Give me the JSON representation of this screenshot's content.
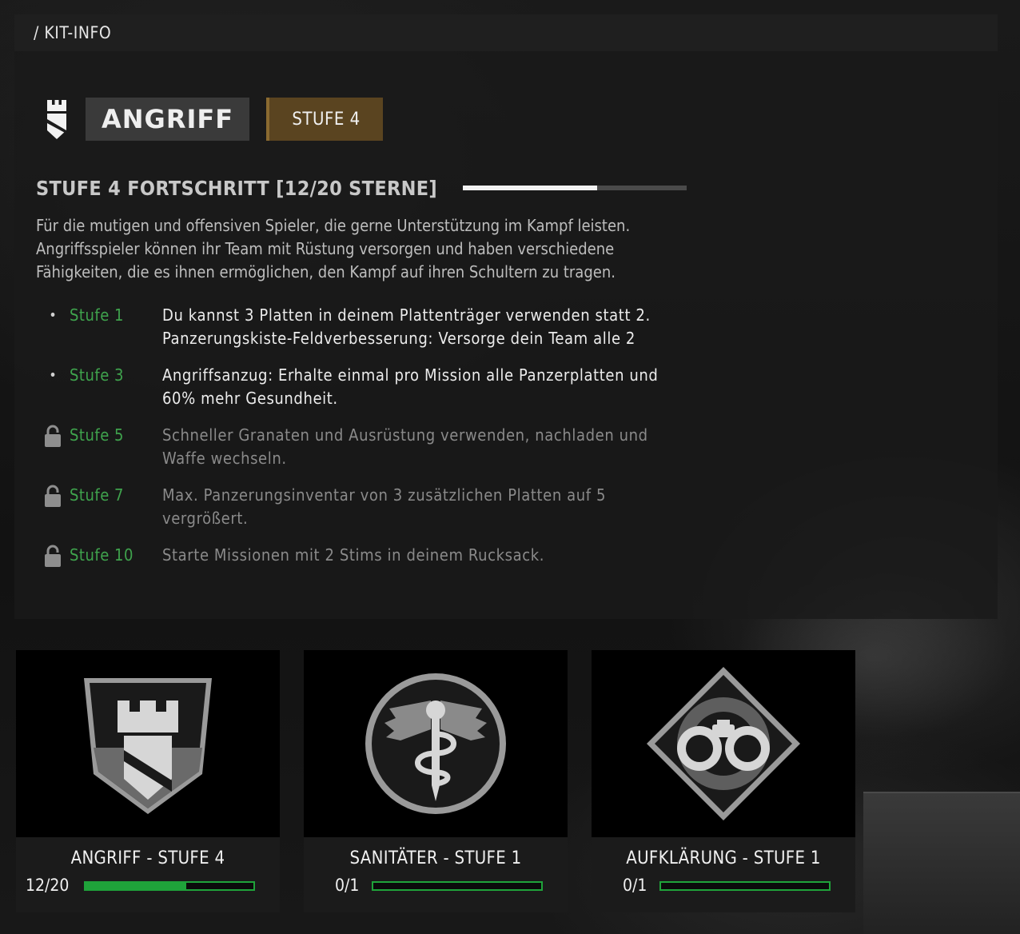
{
  "header": {
    "breadcrumb": "/ KIT-INFO"
  },
  "kit": {
    "icon": "rook-shield-icon",
    "name": "ANGRIFF",
    "level_badge": "STUFE 4",
    "progress_label": "STUFE 4 FORTSCHRITT [12/20 STERNE]",
    "progress_fraction": 0.6,
    "description": [
      "Für die mutigen und offensiven Spieler, die gerne Unterstützung im Kampf leisten.",
      "Angriffsspieler können ihr Team mit Rüstung versorgen und haben verschiedene",
      "Fähigkeiten, die es ihnen ermöglichen, den Kampf auf ihren Schultern zu tragen."
    ]
  },
  "perks": [
    {
      "level": "Stufe 1",
      "locked": false,
      "lines": [
        "Du kannst 3 Platten in deinem Plattenträger verwenden statt 2.",
        "Panzerungskiste-Feldverbesserung: Versorge dein Team alle 2"
      ]
    },
    {
      "level": "Stufe 3",
      "locked": false,
      "lines": [
        "Angriffsanzug: Erhalte einmal pro Mission alle Panzerplatten und",
        "60% mehr Gesundheit."
      ]
    },
    {
      "level": "Stufe 5",
      "locked": true,
      "lines": [
        "Schneller Granaten und Ausrüstung verwenden, nachladen und",
        "Waffe wechseln."
      ]
    },
    {
      "level": "Stufe 7",
      "locked": true,
      "lines": [
        "Max. Panzerungsinventar von 3 zusätzlichen Platten auf 5",
        "vergrößert."
      ]
    },
    {
      "level": "Stufe 10",
      "locked": true,
      "lines": [
        "Starte Missionen mit 2 Stims in deinem Rucksack."
      ]
    }
  ],
  "cards": [
    {
      "title": "ANGRIFF - STUFE 4",
      "count": "12/20",
      "progress_fraction": 0.6,
      "icon": "rook-shield-emblem-icon"
    },
    {
      "title": "SANITÄTER - STUFE 1",
      "count": "0/1",
      "progress_fraction": 0,
      "icon": "caduceus-emblem-icon"
    },
    {
      "title": "AUFKLÄRUNG - STUFE 1",
      "count": "0/1",
      "progress_fraction": 0,
      "icon": "binoculars-emblem-icon"
    }
  ],
  "colors": {
    "accent_green": "#1fa33a",
    "level_badge": "#5a4420",
    "perk_level_text": "#3fa34d"
  }
}
